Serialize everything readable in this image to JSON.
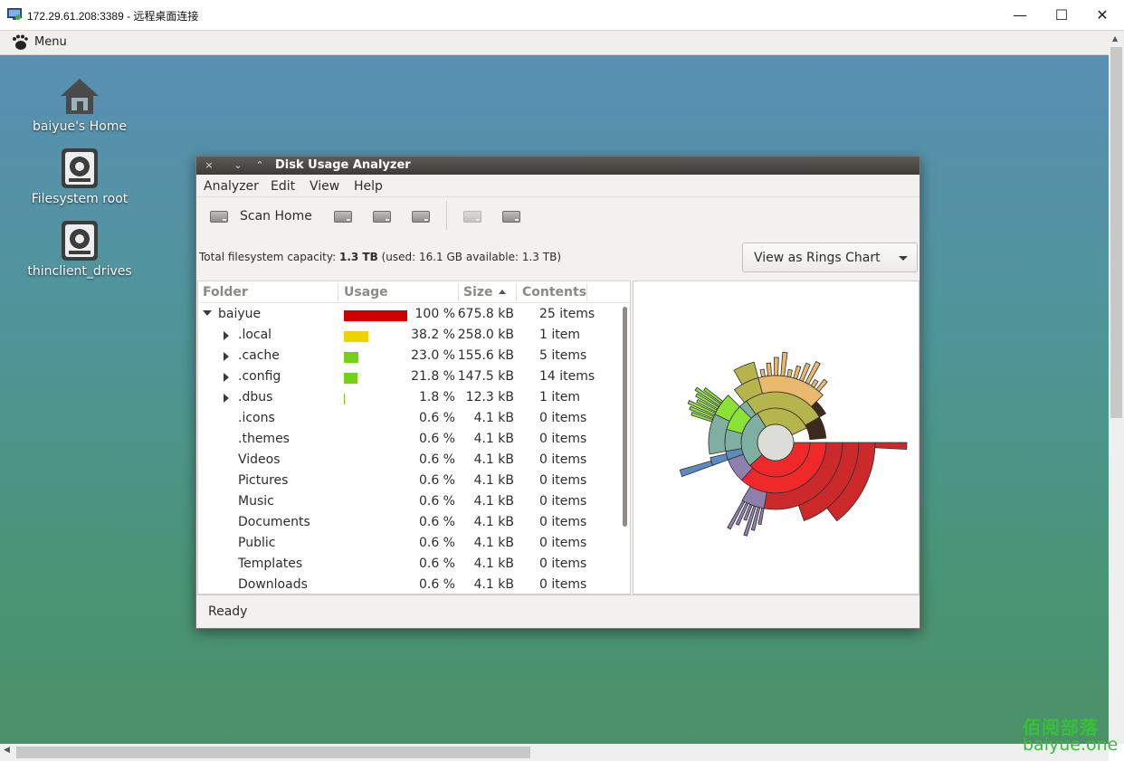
{
  "rdp": {
    "title": "172.29.61.208:3389 - 远程桌面连接",
    "min_glyph": "—",
    "max_glyph": "☐",
    "close_glyph": "✕"
  },
  "panel": {
    "menu_label": "Menu"
  },
  "desktop_icons": [
    {
      "label": "baiyue's Home",
      "icon": "home-icon"
    },
    {
      "label": "Filesystem root",
      "icon": "drive-icon"
    },
    {
      "label": "thinclient_drives",
      "icon": "drive-icon"
    }
  ],
  "app": {
    "title": "Disk Usage Analyzer",
    "window_buttons": {
      "close": "×",
      "minimize": "⌄",
      "maximize": "⌃"
    },
    "menu": [
      "Analyzer",
      "Edit",
      "View",
      "Help"
    ],
    "toolbar": {
      "scan_home": "Scan Home"
    },
    "capacity": {
      "prefix": "Total filesystem capacity: ",
      "total": "1.3 TB",
      "detail": " (used: 16.1 GB available: 1.3 TB)"
    },
    "view_as": "View as Rings Chart",
    "columns": {
      "folder": "Folder",
      "usage": "Usage",
      "size": "Size",
      "contents": "Contents"
    },
    "rows": [
      {
        "name": "baiyue",
        "expander": "open",
        "level": 0,
        "pct": "100 %",
        "size": "675.8 kB",
        "contents": "25 items",
        "fraction": 1.0,
        "bar_color": "#cc0000"
      },
      {
        "name": ".local",
        "expander": "closed",
        "level": 1,
        "pct": "38.2 %",
        "size": "258.0 kB",
        "contents": "1 item",
        "fraction": 0.382,
        "bar_color": "#edd400"
      },
      {
        "name": ".cache",
        "expander": "closed",
        "level": 1,
        "pct": "23.0 %",
        "size": "155.6 kB",
        "contents": "5 items",
        "fraction": 0.23,
        "bar_color": "#73d216"
      },
      {
        "name": ".config",
        "expander": "closed",
        "level": 1,
        "pct": "21.8 %",
        "size": "147.5 kB",
        "contents": "14 items",
        "fraction": 0.218,
        "bar_color": "#73d216"
      },
      {
        "name": ".dbus",
        "expander": "closed",
        "level": 1,
        "pct": "1.8 %",
        "size": "12.3 kB",
        "contents": "1 item",
        "fraction": 0.018,
        "bar_color": "#73d216"
      },
      {
        "name": ".icons",
        "expander": "none",
        "level": 1,
        "pct": "0.6 %",
        "size": "4.1 kB",
        "contents": "0 items",
        "fraction": 0.0,
        "bar_color": "#73d216"
      },
      {
        "name": ".themes",
        "expander": "none",
        "level": 1,
        "pct": "0.6 %",
        "size": "4.1 kB",
        "contents": "0 items",
        "fraction": 0.0,
        "bar_color": "#73d216"
      },
      {
        "name": "Videos",
        "expander": "none",
        "level": 1,
        "pct": "0.6 %",
        "size": "4.1 kB",
        "contents": "0 items",
        "fraction": 0.0,
        "bar_color": "#73d216"
      },
      {
        "name": "Pictures",
        "expander": "none",
        "level": 1,
        "pct": "0.6 %",
        "size": "4.1 kB",
        "contents": "0 items",
        "fraction": 0.0,
        "bar_color": "#73d216"
      },
      {
        "name": "Music",
        "expander": "none",
        "level": 1,
        "pct": "0.6 %",
        "size": "4.1 kB",
        "contents": "0 items",
        "fraction": 0.0,
        "bar_color": "#73d216"
      },
      {
        "name": "Documents",
        "expander": "none",
        "level": 1,
        "pct": "0.6 %",
        "size": "4.1 kB",
        "contents": "0 items",
        "fraction": 0.0,
        "bar_color": "#73d216"
      },
      {
        "name": "Public",
        "expander": "none",
        "level": 1,
        "pct": "0.6 %",
        "size": "4.1 kB",
        "contents": "0 items",
        "fraction": 0.0,
        "bar_color": "#73d216"
      },
      {
        "name": "Templates",
        "expander": "none",
        "level": 1,
        "pct": "0.6 %",
        "size": "4.1 kB",
        "contents": "0 items",
        "fraction": 0.0,
        "bar_color": "#73d216"
      },
      {
        "name": "Downloads",
        "expander": "none",
        "level": 1,
        "pct": "0.6 %",
        "size": "4.1 kB",
        "contents": "0 items",
        "fraction": 0.0,
        "bar_color": "#73d216"
      }
    ],
    "status": "Ready",
    "rings_colors": {
      "red": "#ef2929",
      "dark_red": "#cc2a2a",
      "teal": "#7fafa1",
      "green": "#8ae234",
      "olive": "#b6b44c",
      "orange": "#e9b96e",
      "purple": "#8f7fae",
      "blue": "#5b8bc0",
      "dark": "#3c2a1c",
      "center": "#dcdcd8"
    }
  },
  "watermark": {
    "line1": "佰阅部落",
    "line2": "baiyue.one"
  }
}
